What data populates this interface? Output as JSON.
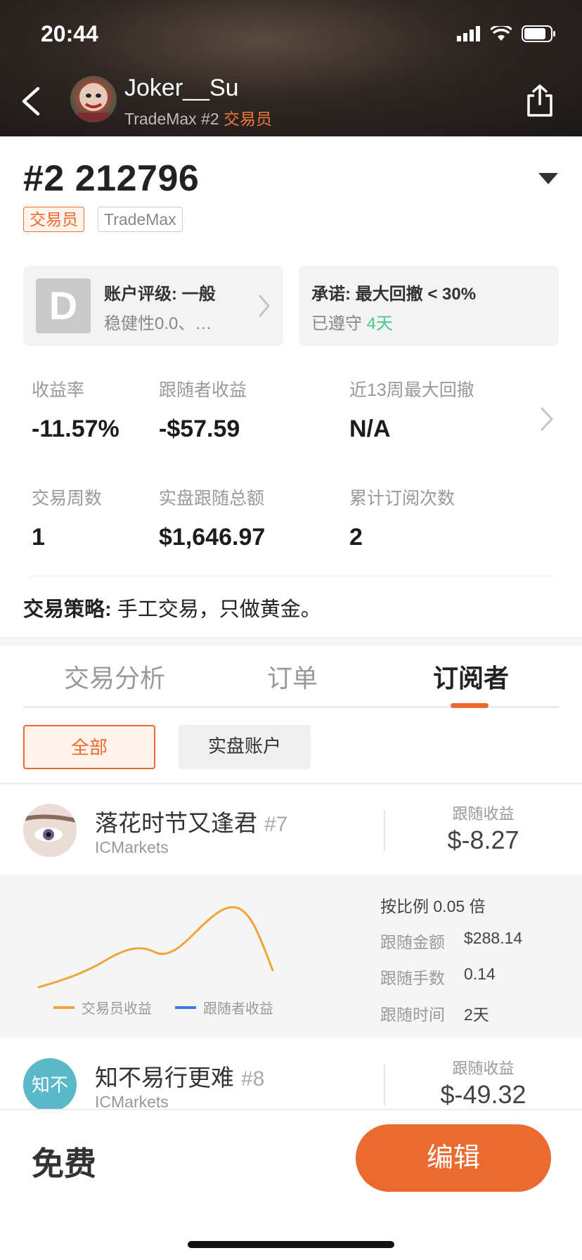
{
  "status_bar": {
    "time": "20:44"
  },
  "header": {
    "name": "Joker__Su",
    "subtitle_prefix": "TradeMax #2",
    "subtitle_role": "交易员",
    "icons": {
      "back": "back-chevron-icon",
      "share": "share-icon"
    }
  },
  "account": {
    "title": "#2 212796",
    "tags": {
      "role": "交易员",
      "broker": "TradeMax"
    }
  },
  "rating_card": {
    "grade": "D",
    "title": "账户评级: 一般",
    "subtitle": "稳健性0.0、…"
  },
  "promise_card": {
    "title": "承诺: 最大回撤 < 30%",
    "kept_prefix": "已遵守",
    "kept_days": "4天"
  },
  "stats": {
    "return_label": "收益率",
    "return_value": "-11.57%",
    "follower_profit_label": "跟随者收益",
    "follower_profit_value": "-$57.59",
    "drawdown_label": "近13周最大回撤",
    "drawdown_value": "N/A",
    "weeks_label": "交易周数",
    "weeks_value": "1",
    "live_total_label": "实盘跟随总额",
    "live_total_value": "$1,646.97",
    "subs_label": "累计订阅次数",
    "subs_value": "2"
  },
  "strategy": {
    "label": "交易策略:",
    "text": " 手工交易，只做黄金。"
  },
  "tabs": [
    "交易分析",
    "订单",
    "订阅者"
  ],
  "active_tab": "订阅者",
  "filters": {
    "all": "全部",
    "live": "实盘账户"
  },
  "subscribers": [
    {
      "name": "落花时节又逢君",
      "rank": "#7",
      "broker": "ICMarkets",
      "profit_label": "跟随收益",
      "profit": "$-8.27"
    },
    {
      "name": "知不易行更难",
      "rank": "#8",
      "broker": "ICMarkets",
      "profit_label": "跟随收益",
      "profit": "$-49.32",
      "avatar_text": "知不"
    }
  ],
  "detail": {
    "ratio": "按比例 0.05 倍",
    "amount_label": "跟随金额",
    "amount": "$288.14",
    "lots_label": "跟随手数",
    "lots": "0.14",
    "time_label": "跟随时间",
    "time": "2天",
    "legend_trader": "交易员收益",
    "legend_follower": "跟随者收益",
    "colors": {
      "trader": "#f0a43a",
      "follower": "#3d7de0"
    }
  },
  "bottom": {
    "price": "免费",
    "edit": "编辑"
  },
  "colors": {
    "accent": "#ec6a2f",
    "green": "#4cc98b"
  }
}
